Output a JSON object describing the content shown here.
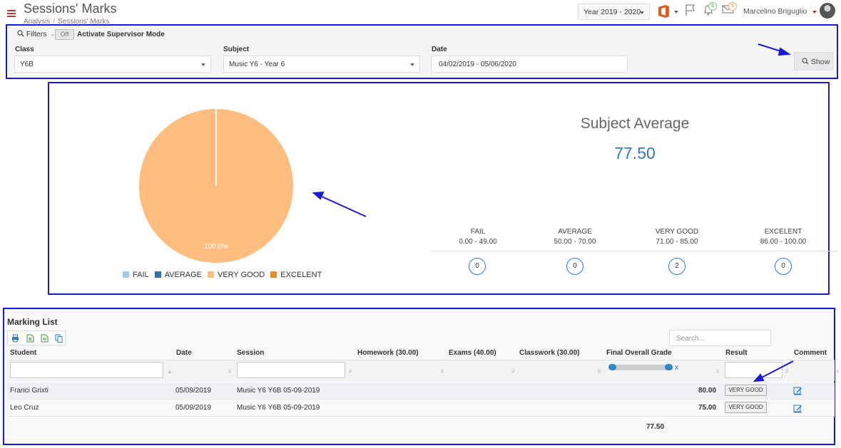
{
  "header": {
    "title": "Sessions' Marks",
    "breadcrumb": [
      "Analysis",
      "Sessions' Marks"
    ],
    "year_select": "Year 2019 - 2020",
    "flag_label": "",
    "bell_count": "5",
    "mail_count": "5",
    "user_name": "Marcelino Briguglio"
  },
  "filters": {
    "label": "Filters",
    "separator": "-",
    "toggle_label": "Off",
    "supervisor_label": "Activate Supervisor Mode",
    "class_label": "Class",
    "class_value": "Y6B",
    "subject_label": "Subject",
    "subject_value": "Music Y6 - Year 6",
    "date_label": "Date",
    "date_value": "04/02/2019 - 05/06/2020",
    "show_label": "Show"
  },
  "chart": {
    "legend": [
      "FAIL",
      "AVERAGE",
      "VERY GOOD",
      "EXCELENT"
    ],
    "slice_label": "100.0%"
  },
  "chart_data": {
    "type": "pie",
    "categories": [
      "FAIL",
      "AVERAGE",
      "VERY GOOD",
      "EXCELENT"
    ],
    "values": [
      0,
      0,
      2,
      0
    ],
    "percent_label": "100.0%",
    "colors": [
      "#a6c8e8",
      "#2e6fb5",
      "#fdbd7f",
      "#f08a24"
    ],
    "legend_position": "bottom"
  },
  "summary": {
    "title": "Subject Average",
    "value": "77.50",
    "bands": [
      {
        "name": "FAIL",
        "range": "0.00 - 49.00",
        "count": "0"
      },
      {
        "name": "AVERAGE",
        "range": "50.00 - 70.00",
        "count": "0"
      },
      {
        "name": "VERY GOOD",
        "range": "71.00 - 85.00",
        "count": "2"
      },
      {
        "name": "EXCELENT",
        "range": "86.00 - 100.00",
        "count": "0"
      }
    ]
  },
  "marking_list": {
    "title": "Marking List",
    "search_placeholder": "Search...",
    "columns": [
      "Student",
      "Date",
      "Session",
      "Homework (30.00)",
      "Exams (40.00)",
      "Classwork (30.00)",
      "Final Overall Grade",
      "Result",
      "Comment"
    ],
    "slider_clear": "x",
    "rows": [
      {
        "student": "Franci Grixti",
        "date": "05/09/2019",
        "session": "Music Y6 Y6B 05-09-2019",
        "final": "80.00",
        "result": "VERY GOOD"
      },
      {
        "student": "Leo Cruz",
        "date": "05/09/2019",
        "session": "Music Y6 Y6B 05-09-2019",
        "final": "75.00",
        "result": "VERY GOOD"
      }
    ],
    "total": "77.50"
  },
  "colors": {
    "annotation": "#1a1ad6",
    "accent": "#2e7bbf",
    "brand_red": "#b03a2e"
  }
}
